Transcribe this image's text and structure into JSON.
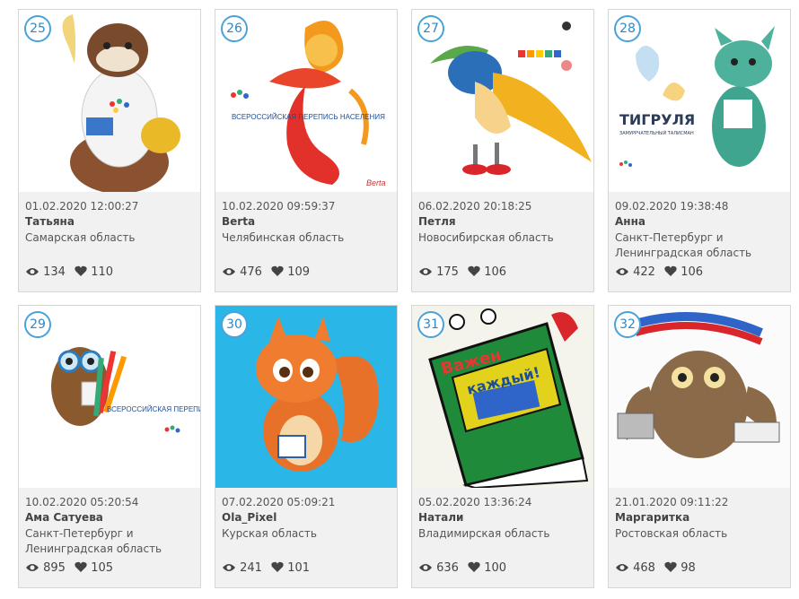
{
  "cards": [
    {
      "number": "25",
      "date": "01.02.2020 12:00:27",
      "author": "Татьяна",
      "region": "Самарская область",
      "views": "134",
      "likes": "110",
      "image": "sable-mascot-with-feather"
    },
    {
      "number": "26",
      "date": "10.02.2020 09:59:37",
      "author": "Berta",
      "region": "Челябинская область",
      "views": "476",
      "likes": "109",
      "image": "fire-bird-mascot"
    },
    {
      "number": "27",
      "date": "06.02.2020 20:18:25",
      "author": "Петля",
      "region": "Новосибирская область",
      "views": "175",
      "likes": "106",
      "image": "bird-in-cap-mascot"
    },
    {
      "number": "28",
      "date": "09.02.2020 19:38:48",
      "author": "Анна",
      "region": "Санкт-Петербург и Ленинградская область",
      "views": "422",
      "likes": "106",
      "image": "tiger-mascot"
    },
    {
      "number": "29",
      "date": "10.02.2020 05:20:54",
      "author": "Ама Сатуева",
      "region": "Санкт-Петербург и Ленинградская область",
      "views": "895",
      "likes": "105",
      "image": "owl-with-pencils"
    },
    {
      "number": "30",
      "date": "07.02.2020 05:09:21",
      "author": "Ola_Pixel",
      "region": "Курская область",
      "views": "241",
      "likes": "101",
      "image": "squirrel-mascot"
    },
    {
      "number": "31",
      "date": "05.02.2020 13:36:24",
      "author": "Натали",
      "region": "Владимирская область",
      "views": "636",
      "likes": "100",
      "image": "book-mascot"
    },
    {
      "number": "32",
      "date": "21.01.2020 09:11:22",
      "author": "Маргаритка",
      "region": "Ростовская область",
      "views": "468",
      "likes": "98",
      "image": "owl-with-laptop"
    }
  ],
  "thumb_text": {
    "census_logo": "ВСЕРОССИЙСКАЯ ПЕРЕПИСЬ НАСЕЛЕНИЯ",
    "berta_sign": "Berta",
    "tiger_title": "ТИГРУЛЯ",
    "tiger_sub": "ЗАМУРРЧАТЕЛЬНЫЙ ТАЛИСМАН",
    "book_word1": "Важен",
    "book_word2": "каждый!"
  },
  "icons": {
    "views": "eye-icon",
    "likes": "heart-icon"
  },
  "colors": {
    "badge": "#2f88c6",
    "card_bg": "#f1f1f1",
    "border": "#d6d6d6"
  }
}
